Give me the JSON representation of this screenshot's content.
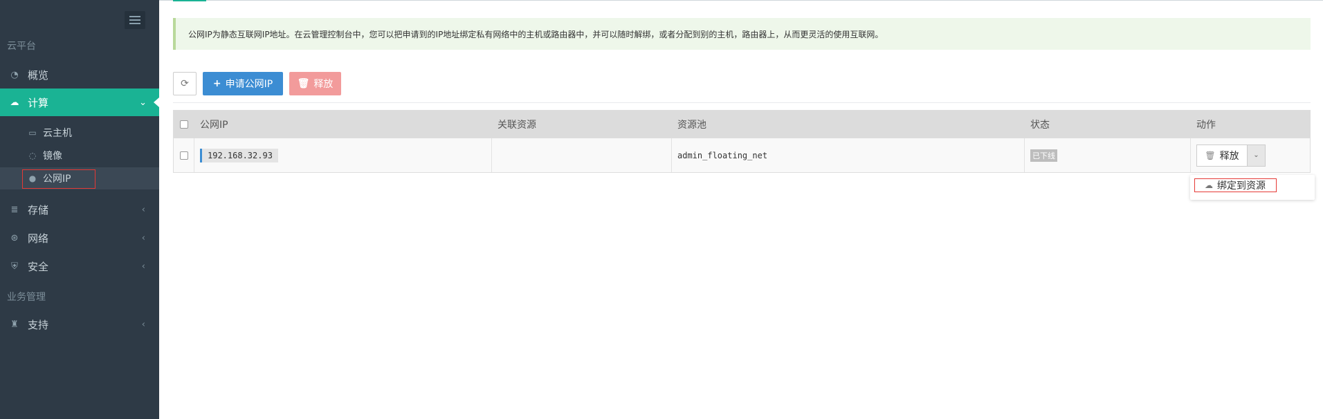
{
  "sidebar": {
    "sections": [
      {
        "label": "云平台"
      },
      {
        "label": "业务管理"
      }
    ],
    "items": [
      {
        "label": "概览",
        "icon": "dashboard-icon"
      },
      {
        "label": "计算",
        "icon": "cloud-icon"
      },
      {
        "label": "存储",
        "icon": "database-icon"
      },
      {
        "label": "网络",
        "icon": "network-icon"
      },
      {
        "label": "安全",
        "icon": "shield-icon"
      },
      {
        "label": "支持",
        "icon": "support-icon"
      }
    ],
    "compute_sub": [
      {
        "label": "云主机",
        "icon": "monitor-icon"
      },
      {
        "label": "镜像",
        "icon": "image-icon"
      },
      {
        "label": "公网IP",
        "icon": "globe-icon"
      }
    ]
  },
  "alert": {
    "text": "公网IP为静态互联网IP地址。在云管理控制台中，您可以把申请到的IP地址绑定私有网络中的主机或路由器中，并可以随时解绑，或者分配到别的主机，路由器上，从而更灵活的使用互联网。"
  },
  "toolbar": {
    "apply_label": "申请公网IP",
    "release_label": "释放"
  },
  "table": {
    "columns": [
      "公网IP",
      "关联资源",
      "资源池",
      "状态",
      "动作"
    ],
    "rows": [
      {
        "ip": "192.168.32.93",
        "resource": "",
        "pool": "admin_floating_net",
        "status": "已下线",
        "action": "释放"
      }
    ]
  },
  "dropdown": {
    "items": [
      {
        "label": "绑定到资源"
      }
    ]
  },
  "colors": {
    "sidebar_bg": "#2e3a46",
    "active": "#1ab394",
    "primary": "#3c8dd3",
    "danger_light": "#f29b9b"
  }
}
